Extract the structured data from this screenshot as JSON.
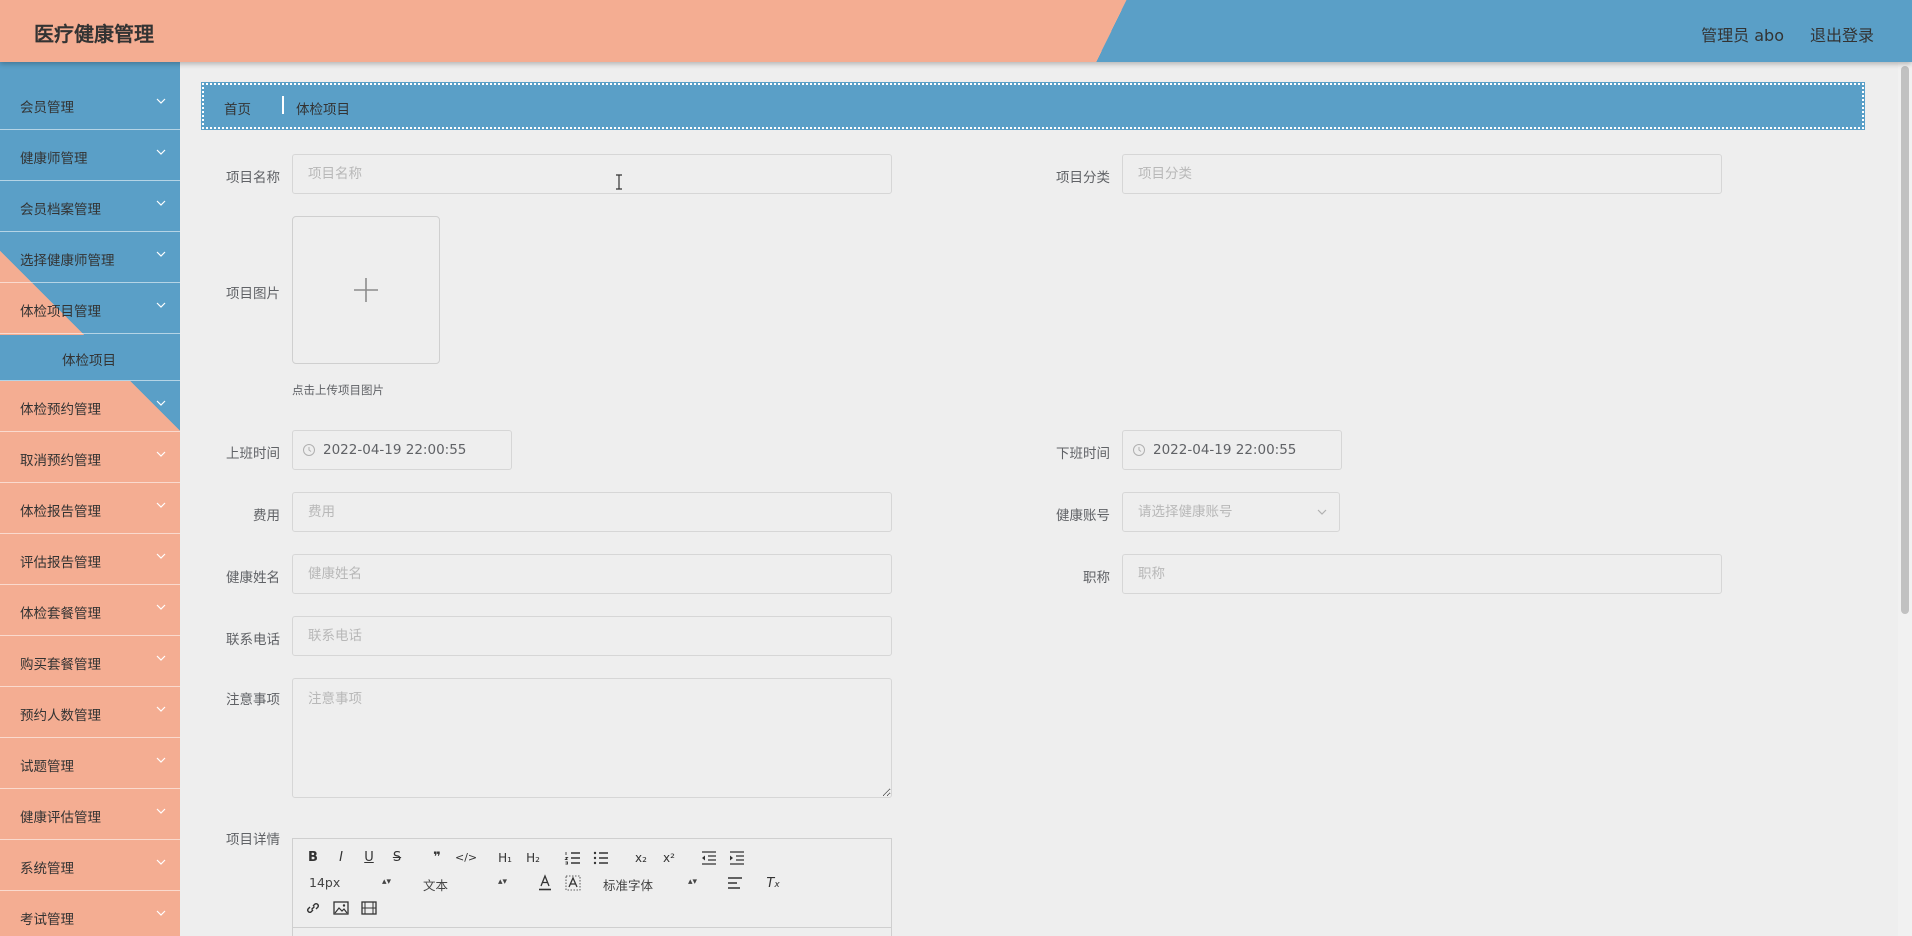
{
  "header": {
    "title": "医疗健康管理",
    "user": "管理员 abo",
    "logout": "退出登录"
  },
  "sidebar": {
    "items": [
      {
        "label": "会员管理"
      },
      {
        "label": "健康师管理"
      },
      {
        "label": "会员档案管理"
      },
      {
        "label": "选择健康师管理"
      },
      {
        "label": "体检项目管理"
      },
      {
        "label": "体检项目",
        "sub": true
      },
      {
        "label": "体检预约管理"
      },
      {
        "label": "取消预约管理"
      },
      {
        "label": "体检报告管理"
      },
      {
        "label": "评估报告管理"
      },
      {
        "label": "体检套餐管理"
      },
      {
        "label": "购买套餐管理"
      },
      {
        "label": "预约人数管理"
      },
      {
        "label": "试题管理"
      },
      {
        "label": "健康评估管理"
      },
      {
        "label": "系统管理"
      },
      {
        "label": "考试管理"
      }
    ]
  },
  "breadcrumb": {
    "home": "首页",
    "current": "体检项目"
  },
  "form": {
    "item_name": {
      "label": "项目名称",
      "placeholder": "项目名称"
    },
    "item_category": {
      "label": "项目分类",
      "placeholder": "项目分类"
    },
    "item_image": {
      "label": "项目图片",
      "tip": "点击上传项目图片"
    },
    "start_time": {
      "label": "上班时间",
      "value": "2022-04-19 22:00:55"
    },
    "end_time": {
      "label": "下班时间",
      "value": "2022-04-19 22:00:55"
    },
    "fee": {
      "label": "费用",
      "placeholder": "费用"
    },
    "health_account": {
      "label": "健康账号",
      "placeholder": "请选择健康账号"
    },
    "health_name": {
      "label": "健康姓名",
      "placeholder": "健康姓名"
    },
    "title": {
      "label": "职称",
      "placeholder": "职称"
    },
    "phone": {
      "label": "联系电话",
      "placeholder": "联系电话"
    },
    "notes": {
      "label": "注意事项",
      "placeholder": "注意事项"
    },
    "details": {
      "label": "项目详情"
    }
  },
  "editor": {
    "font_size": "14px",
    "header_select": "文本",
    "font_family": "标准字体"
  },
  "colors": {
    "orange": "#f4ad92",
    "blue": "#5a9fc7",
    "background": "#eeeeee"
  }
}
